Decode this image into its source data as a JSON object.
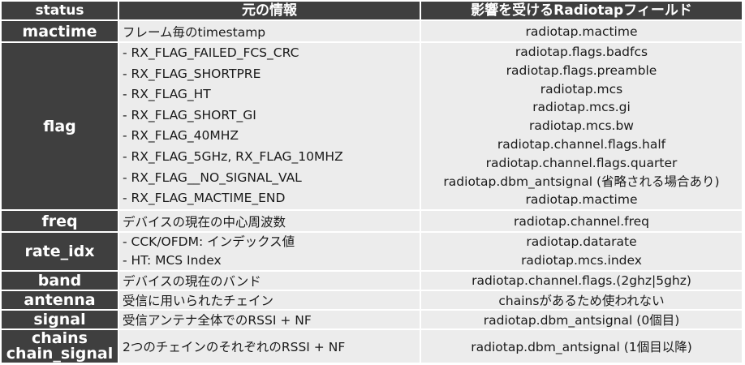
{
  "headers": {
    "status": "status",
    "info": "元の情報",
    "field": "影響を受けるRadiotapフィールド"
  },
  "rows": {
    "mactime": {
      "status": "mactime",
      "info": "フレーム毎のtimestamp",
      "field": "radiotap.mactime"
    },
    "flag": {
      "status": "flag",
      "info": [
        "- RX_FLAG_FAILED_FCS_CRC",
        "- RX_FLAG_SHORTPRE",
        "- RX_FLAG_HT",
        "- RX_FLAG_SHORT_GI",
        "- RX_FLAG_40MHZ",
        "- RX_FLAG_5GHz, RX_FLAG_10MHZ",
        "- RX_FLAG__NO_SIGNAL_VAL",
        "- RX_FLAG_MACTIME_END"
      ],
      "field": [
        "radiotap.flags.badfcs",
        "radiotap.flags.preamble",
        "radiotap.mcs",
        "radiotap.mcs.gi",
        "radiotap.mcs.bw",
        "radiotap.channel.flags.half",
        "radiotap.channel.flags.quarter",
        "radiotap.dbm_antsignal (省略される場合あり)",
        "radiotap.mactime"
      ]
    },
    "freq": {
      "status": "freq",
      "info": "デバイスの現在の中心周波数",
      "field": "radiotap.channel.freq"
    },
    "rate_idx": {
      "status": "rate_idx",
      "info": [
        "- CCK/OFDM: インデックス値",
        "- HT: MCS Index"
      ],
      "field": [
        "radiotap.datarate",
        "radiotap.mcs.index"
      ]
    },
    "band": {
      "status": "band",
      "info": "デバイスの現在のバンド",
      "field": "radiotap.channel.flags.(2ghz|5ghz)"
    },
    "antenna": {
      "status": "antenna",
      "info": "受信に用いられたチェイン",
      "field": "chainsがあるため使われない"
    },
    "signal": {
      "status": "signal",
      "info": "受信アンテナ全体でのRSSI + NF",
      "field": "radiotap.dbm_antsignal (0個目)"
    },
    "chains": {
      "status_line1": "chains",
      "status_line2": "chain_signal",
      "info": "2つのチェインのそれぞれのRSSI + NF",
      "field": "radiotap.dbm_antsignal (1個目以降)"
    }
  }
}
